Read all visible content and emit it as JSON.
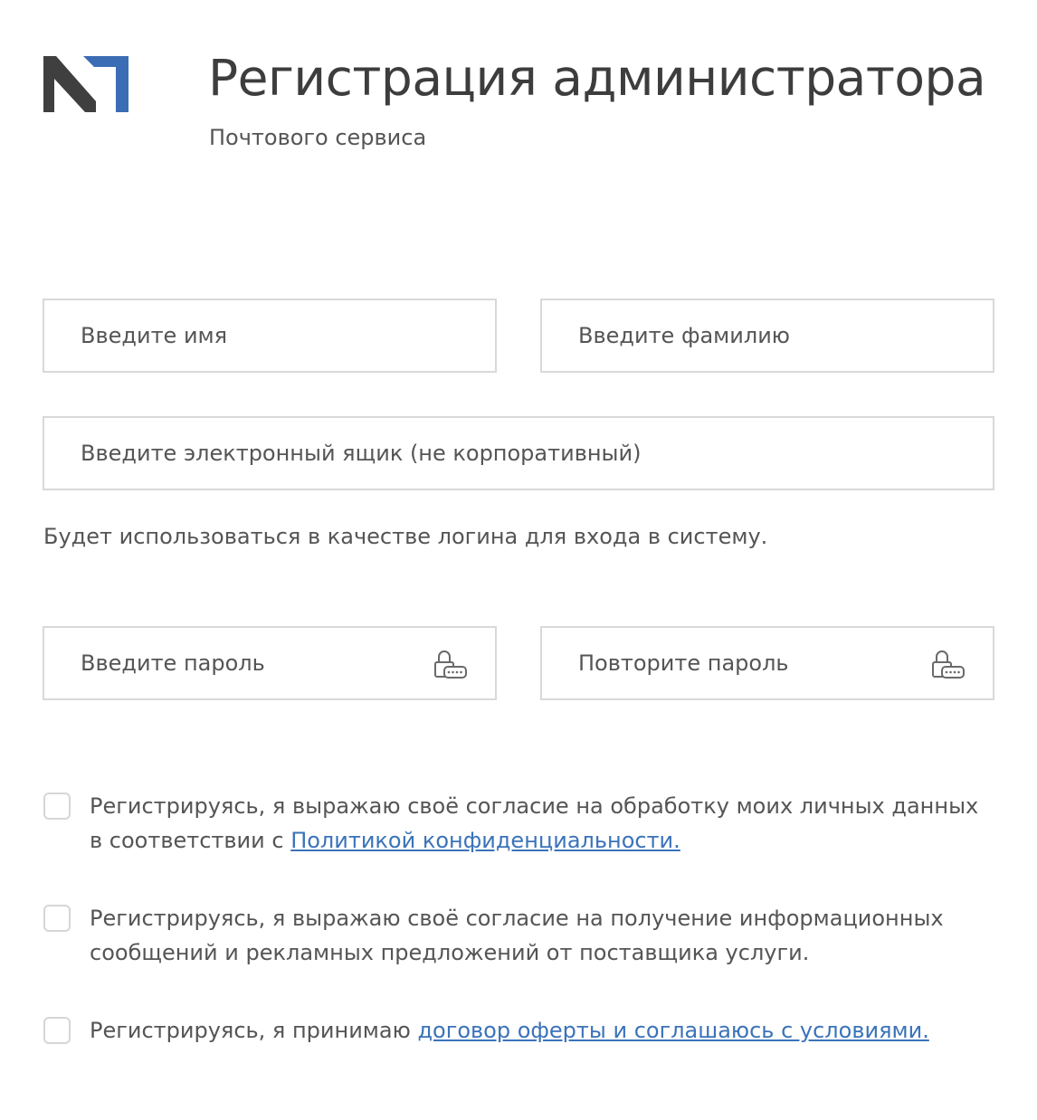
{
  "header": {
    "title": "Регистрация администратора",
    "subtitle": "Почтового сервиса",
    "logo_icon": "m-logo-icon",
    "logo_colors": {
      "dark": "#3f3f3f",
      "accent": "#3b6db4"
    }
  },
  "form": {
    "first_name_placeholder": "Введите имя",
    "last_name_placeholder": "Введите фамилию",
    "email_placeholder": "Введите электронный ящик (не корпоративный)",
    "email_hint": "Будет использоваться в качестве логина для входа в систему.",
    "password_placeholder": "Введите пароль",
    "password_repeat_placeholder": "Повторите пароль",
    "password_icon": "password-lock-icon"
  },
  "consents": [
    {
      "text_before": "Регистрируясь, я выражаю своё согласие на обработку моих личных данных в соответствии с ",
      "link_text": "Политикой конфиденциальности.",
      "checked": false
    },
    {
      "text_before": "Регистрируясь, я выражаю своё согласие на получение информационных сообщений и рекламных предложений от поставщика услуги.",
      "link_text": "",
      "checked": false
    },
    {
      "text_before": "Регистрируясь, я принимаю ",
      "link_text": "договор оферты и соглашаюсь с условиями.",
      "checked": false
    }
  ],
  "colors": {
    "link": "#3b73b9",
    "border": "#d9d9d9",
    "text": "#555555"
  }
}
